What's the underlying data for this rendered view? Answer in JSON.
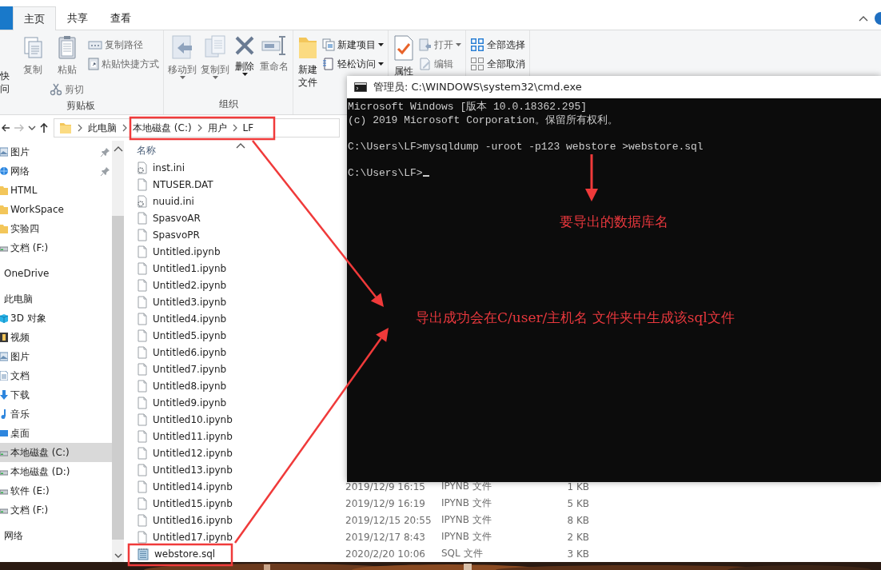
{
  "explorer": {
    "tabs": [
      {
        "label": "主页",
        "selected": true
      },
      {
        "label": "共享",
        "selected": false
      },
      {
        "label": "查看",
        "selected": false
      }
    ],
    "ribbon": {
      "groups": [
        {
          "label": "剪贴板",
          "columns": [
            {
              "kind": "large",
              "lines": [
                "快",
                "问"
              ]
            },
            {
              "kind": "large",
              "lines": [
                "复制"
              ],
              "disabled": true
            },
            {
              "kind": "large",
              "lines": [
                "粘贴"
              ],
              "disabled": true,
              "sub": {
                "label": "剪切",
                "disabled": true
              }
            },
            {
              "kind": "stack",
              "items": [
                {
                  "label": "复制路径",
                  "disabled": true
                },
                {
                  "label": "粘贴快捷方式",
                  "disabled": true
                }
              ]
            }
          ]
        },
        {
          "label": "组织",
          "columns": [
            {
              "kind": "large",
              "lines": [
                "移动到"
              ],
              "disabled": true,
              "dropdown": true
            },
            {
              "kind": "large",
              "lines": [
                "复制到"
              ],
              "disabled": true,
              "dropdown": true
            },
            {
              "kind": "large",
              "lines": [
                "删除"
              ],
              "disabled": false,
              "dropdown": true
            },
            {
              "kind": "large",
              "lines": [
                "重命名"
              ],
              "disabled": true
            }
          ]
        },
        {
          "columns": [
            {
              "kind": "large",
              "lines": [
                "新建",
                "文件"
              ]
            },
            {
              "kind": "stack",
              "items": [
                {
                  "label": "新建项目",
                  "dropdown": true,
                  "disabled": false
                },
                {
                  "label": "轻松访问",
                  "dropdown": true,
                  "disabled": false
                }
              ]
            }
          ]
        },
        {
          "columns": [
            {
              "kind": "large",
              "lines": [
                "属性"
              ]
            },
            {
              "kind": "stack",
              "items": [
                {
                  "label": "打开",
                  "dropdown": true,
                  "disabled": true
                },
                {
                  "label": "编辑",
                  "disabled": true
                }
              ]
            }
          ]
        },
        {
          "columns": [
            {
              "kind": "stack",
              "items": [
                {
                  "label": "全部选择",
                  "disabled": false
                },
                {
                  "label": "全部取消",
                  "disabled": false
                }
              ]
            }
          ]
        }
      ]
    },
    "address": {
      "crumbs": [
        "此电脑",
        "本地磁盘 (C:)",
        "用户",
        "LF"
      ]
    },
    "nav": [
      {
        "kind": "pictures",
        "label": "图片",
        "pinned": true,
        "selected": false
      },
      {
        "kind": "network",
        "label": "网络",
        "pinned": true,
        "selected": false
      },
      {
        "kind": "folder",
        "label": "HTML",
        "pinned": false,
        "selected": false
      },
      {
        "kind": "folder",
        "label": "WorkSpace",
        "pinned": false,
        "selected": false
      },
      {
        "kind": "folder",
        "label": "实验四",
        "pinned": false,
        "selected": false
      },
      {
        "kind": "drive",
        "label": "文档 (F:)",
        "pinned": false,
        "selected": false
      },
      {
        "kind": "section",
        "label": "OneDrive",
        "selected": false
      },
      {
        "kind": "section",
        "label": "此电脑",
        "selected": false
      },
      {
        "kind": "cube",
        "label": "3D 对象",
        "pinned": false,
        "selected": false
      },
      {
        "kind": "film",
        "label": "视频",
        "pinned": false,
        "selected": false
      },
      {
        "kind": "pictures",
        "label": "图片",
        "pinned": false,
        "selected": false
      },
      {
        "kind": "document",
        "label": "文档",
        "pinned": false,
        "selected": false
      },
      {
        "kind": "download",
        "label": "下载",
        "pinned": false,
        "selected": false
      },
      {
        "kind": "music",
        "label": "音乐",
        "pinned": false,
        "selected": false
      },
      {
        "kind": "desktop",
        "label": "桌面",
        "pinned": false,
        "selected": false
      },
      {
        "kind": "drive",
        "label": "本地磁盘 (C:)",
        "pinned": false,
        "selected": true
      },
      {
        "kind": "drive",
        "label": "本地磁盘 (D:)",
        "pinned": false,
        "selected": false
      },
      {
        "kind": "drive",
        "label": "软件 (E:)",
        "pinned": false,
        "selected": false
      },
      {
        "kind": "drive",
        "label": "文档 (F:)",
        "pinned": false,
        "selected": false
      },
      {
        "kind": "section",
        "label": "网络",
        "selected": false
      }
    ],
    "files": {
      "header": "名称",
      "rows": [
        {
          "kind": "config",
          "name": "inst.ini"
        },
        {
          "kind": "file",
          "name": "NTUSER.DAT"
        },
        {
          "kind": "config",
          "name": "nuuid.ini"
        },
        {
          "kind": "file",
          "name": "SpasvoAR"
        },
        {
          "kind": "file",
          "name": "SpasvoPR"
        },
        {
          "kind": "file",
          "name": "Untitled.ipynb"
        },
        {
          "kind": "file",
          "name": "Untitled1.ipynb"
        },
        {
          "kind": "file",
          "name": "Untitled2.ipynb"
        },
        {
          "kind": "file",
          "name": "Untitled3.ipynb"
        },
        {
          "kind": "file",
          "name": "Untitled4.ipynb"
        },
        {
          "kind": "file",
          "name": "Untitled5.ipynb"
        },
        {
          "kind": "file",
          "name": "Untitled6.ipynb"
        },
        {
          "kind": "file",
          "name": "Untitled7.ipynb"
        },
        {
          "kind": "file",
          "name": "Untitled8.ipynb"
        },
        {
          "kind": "file",
          "name": "Untitled9.ipynb"
        },
        {
          "kind": "file",
          "name": "Untitled10.ipynb"
        },
        {
          "kind": "file",
          "name": "Untitled11.ipynb"
        },
        {
          "kind": "file",
          "name": "Untitled12.ipynb"
        },
        {
          "kind": "file",
          "name": "Untitled13.ipynb"
        },
        {
          "kind": "file",
          "name": "Untitled14.ipynb",
          "date": "2019/12/9 16:15",
          "type": "IPYNB 文件",
          "size": "1 KB"
        },
        {
          "kind": "file",
          "name": "Untitled15.ipynb",
          "date": "2019/12/9 16:19",
          "type": "IPYNB 文件",
          "size": "5 KB"
        },
        {
          "kind": "file",
          "name": "Untitled16.ipynb",
          "date": "2019/12/15 20:55",
          "type": "IPYNB 文件",
          "size": "8 KB"
        },
        {
          "kind": "file",
          "name": "Untitled17.ipynb",
          "date": "2019/12/17 8:43",
          "type": "IPYNB 文件",
          "size": "2 KB"
        },
        {
          "kind": "text",
          "name": "webstore.sql",
          "date": "2020/2/20 10:06",
          "type": "SQL 文件",
          "size": "3 KB"
        }
      ]
    }
  },
  "cmd": {
    "title": "管理员: C:\\WINDOWS\\system32\\cmd.exe",
    "lines": [
      {
        "kind": "output",
        "text": "Microsoft Windows [版本 10.0.18362.295]"
      },
      {
        "kind": "output",
        "text": "(c) 2019 Microsoft Corporation。保留所有权利。"
      },
      {
        "kind": "command",
        "text": "C:\\Users\\LF>mysqldump -uroot -p123 webstore >webstore.sql"
      },
      {
        "kind": "prompt",
        "text": "C:\\Users\\LF>"
      }
    ]
  },
  "annotations": [
    {
      "kind": "callout",
      "text": "要导出的数据库名"
    },
    {
      "kind": "callout",
      "text": "导出成功会在C/user/主机名 文件夹中生成该sql文件"
    }
  ]
}
